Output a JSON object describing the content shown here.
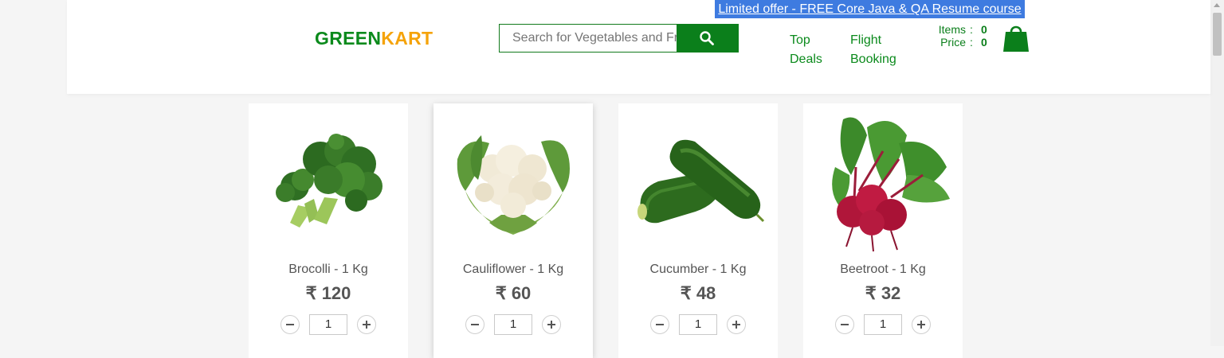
{
  "promo": {
    "text": "Limited offer - FREE Core Java & QA Resume course",
    "color": "#3e7be0"
  },
  "brand": {
    "part1": "GREEN",
    "part2": "KART",
    "color1": "#0b8a1c",
    "color2": "#f5a30a"
  },
  "search": {
    "placeholder": "Search for Vegetables and Fruits",
    "button_icon": "search-icon"
  },
  "nav": [
    {
      "line1": "Top",
      "line2": "Deals"
    },
    {
      "line1": "Flight",
      "line2": "Booking"
    }
  ],
  "cart": {
    "items_label": "Items",
    "items_value": "0",
    "price_label": "Price",
    "price_value": "0",
    "separator": ":",
    "icon": "shopping-bag-icon"
  },
  "products": [
    {
      "name": "Brocolli - 1 Kg",
      "price": "₹ 120",
      "qty": "1",
      "image_icon": "broccoli-image"
    },
    {
      "name": "Cauliflower - 1 Kg",
      "price": "₹ 60",
      "qty": "1",
      "image_icon": "cauliflower-image"
    },
    {
      "name": "Cucumber - 1 Kg",
      "price": "₹ 48",
      "qty": "1",
      "image_icon": "cucumber-image"
    },
    {
      "name": "Beetroot - 1 Kg",
      "price": "₹ 32",
      "qty": "1",
      "image_icon": "beetroot-image"
    }
  ]
}
